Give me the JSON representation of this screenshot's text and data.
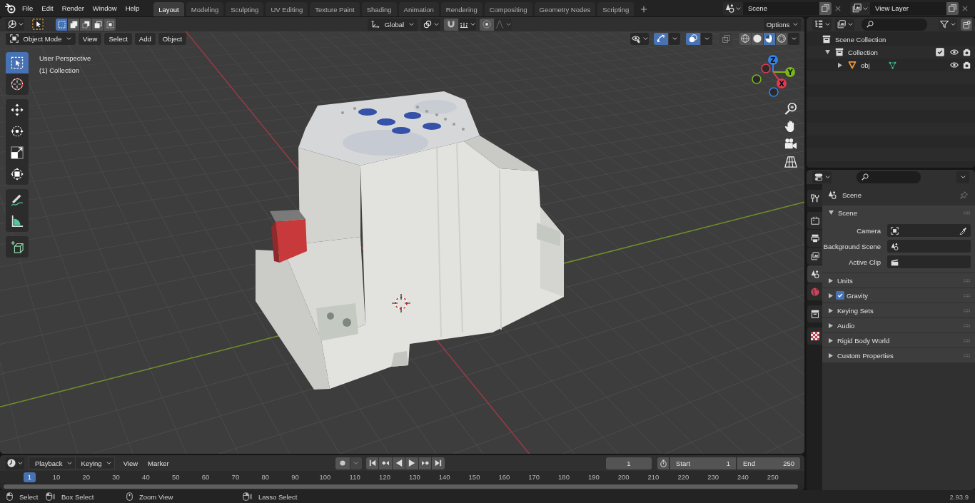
{
  "topbar": {
    "menus": [
      "File",
      "Edit",
      "Render",
      "Window",
      "Help"
    ],
    "workspaces": [
      {
        "label": "Layout",
        "selected": true
      },
      {
        "label": "Modeling",
        "selected": false
      },
      {
        "label": "Sculpting",
        "selected": false
      },
      {
        "label": "UV Editing",
        "selected": false
      },
      {
        "label": "Texture Paint",
        "selected": false
      },
      {
        "label": "Shading",
        "selected": false
      },
      {
        "label": "Animation",
        "selected": false
      },
      {
        "label": "Rendering",
        "selected": false
      },
      {
        "label": "Compositing",
        "selected": false
      },
      {
        "label": "Geometry Nodes",
        "selected": false
      },
      {
        "label": "Scripting",
        "selected": false
      }
    ],
    "scene": "Scene",
    "view_layer": "View Layer"
  },
  "tool_header": {
    "select_modes": [
      {
        "kind": "set",
        "selected": true
      },
      {
        "kind": "extend",
        "selected": false
      },
      {
        "kind": "subtract",
        "selected": false
      },
      {
        "kind": "invert",
        "selected": false
      },
      {
        "kind": "intersect",
        "selected": false
      }
    ],
    "orientation": "Global",
    "snap_on": false,
    "proportional_on": false,
    "options": "Options"
  },
  "viewport": {
    "mode": "Object Mode",
    "menus": [
      "View",
      "Select",
      "Add",
      "Object"
    ],
    "gizmos_on": true,
    "overlays_on": true,
    "xray_on": false,
    "shading": [
      {
        "kind": "wireframe",
        "selected": false
      },
      {
        "kind": "solid",
        "selected": false
      },
      {
        "kind": "material",
        "selected": true
      },
      {
        "kind": "rendered",
        "selected": false
      }
    ],
    "info": [
      "User Perspective",
      "(1) Collection"
    ],
    "tool_groups": [
      [
        {
          "kind": "select-box",
          "selected": true
        },
        {
          "kind": "cursor",
          "selected": false
        }
      ],
      [
        {
          "kind": "move",
          "selected": false
        },
        {
          "kind": "rotate",
          "selected": false
        },
        {
          "kind": "scale",
          "selected": false
        },
        {
          "kind": "transform",
          "selected": false
        }
      ],
      [
        {
          "kind": "annotate",
          "selected": false
        },
        {
          "kind": "measure",
          "selected": false
        }
      ],
      [
        {
          "kind": "add-cube",
          "selected": false
        }
      ]
    ],
    "gizmo_axes": [
      {
        "label": "Z",
        "color": "#2f83e8"
      },
      {
        "label": "Y",
        "color": "#7ab51c"
      },
      {
        "label": "X",
        "color": "#e8384f"
      }
    ]
  },
  "outliner": {
    "tree": [
      {
        "label": "Scene Collection",
        "kind": "scene-collection",
        "children": [
          {
            "label": "Collection",
            "kind": "collection",
            "expanded": true,
            "checkbox": {
              "checked": true
            },
            "children": [
              {
                "label": "obj",
                "kind": "mesh-object",
                "expanded": false
              }
            ]
          }
        ]
      }
    ]
  },
  "properties": {
    "tab_groups": [
      [
        {
          "kind": "tool",
          "selected": false
        }
      ],
      [
        {
          "kind": "render",
          "selected": false
        },
        {
          "kind": "output",
          "selected": false
        },
        {
          "kind": "view-layer",
          "selected": false
        },
        {
          "kind": "scene",
          "selected": true
        },
        {
          "kind": "world",
          "selected": false
        }
      ],
      [
        {
          "kind": "collection",
          "selected": false
        }
      ],
      [
        {
          "kind": "texture",
          "selected": false
        }
      ]
    ],
    "context": "Scene",
    "panels": [
      {
        "title": "Scene",
        "expanded": true,
        "fields": [
          {
            "label": "Camera",
            "kind": "object"
          },
          {
            "label": "Background Scene",
            "kind": "scene"
          },
          {
            "label": "Active Clip",
            "kind": "clip"
          }
        ]
      },
      {
        "title": "Units",
        "expanded": false
      },
      {
        "title": "Gravity",
        "expanded": false,
        "checkbox": {
          "checked": true
        }
      },
      {
        "title": "Keying Sets",
        "expanded": false
      },
      {
        "title": "Audio",
        "expanded": false
      },
      {
        "title": "Rigid Body World",
        "expanded": false
      },
      {
        "title": "Custom Properties",
        "expanded": false
      }
    ]
  },
  "timeline": {
    "menus": [
      {
        "label": "Playback",
        "kind": "dropdown"
      },
      {
        "label": "Keying",
        "kind": "dropdown"
      },
      {
        "label": "View",
        "kind": "menu"
      },
      {
        "label": "Marker",
        "kind": "menu"
      }
    ],
    "current_frame": "1",
    "start_label": "Start",
    "start": "1",
    "end_label": "End",
    "end": "250",
    "playhead": "1",
    "ticks": [
      "10",
      "20",
      "30",
      "40",
      "50",
      "60",
      "70",
      "80",
      "90",
      "100",
      "110",
      "120",
      "130",
      "140",
      "150",
      "160",
      "170",
      "180",
      "190",
      "200",
      "210",
      "220",
      "230",
      "240",
      "250"
    ]
  },
  "status_bar": {
    "hints": [
      {
        "label": "Select",
        "kind": "left-click"
      },
      {
        "label": "Box Select",
        "kind": "left-drag"
      },
      {
        "label": "Zoom View",
        "kind": "middle-drag"
      },
      {
        "label": "Lasso Select",
        "kind": "right-drag"
      }
    ],
    "version": "2.93.9"
  }
}
